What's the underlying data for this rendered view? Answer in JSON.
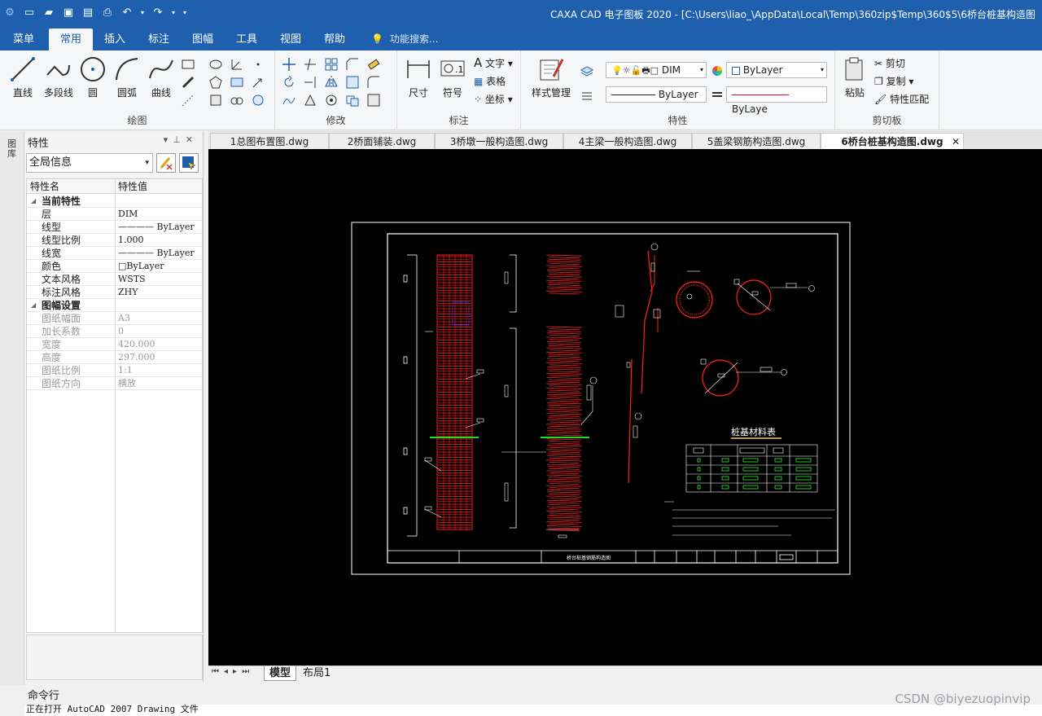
{
  "app": {
    "window_title": "CAXA CAD 电子图板 2020 - [C:\\Users\\liao_\\AppData\\Local\\Temp\\360zip$Temp\\360$5\\6桥台桩基构造图"
  },
  "menu": {
    "tabs": [
      "菜单",
      "常用",
      "插入",
      "标注",
      "图幅",
      "工具",
      "视图",
      "帮助"
    ],
    "active": "常用",
    "search_placeholder": "功能搜索..."
  },
  "ribbon": {
    "draw": {
      "label": "绘图",
      "line": "直线",
      "polyline": "多段线",
      "circle": "圆",
      "arc": "圆弧",
      "curve": "曲线"
    },
    "modify": {
      "label": "修改"
    },
    "annotate": {
      "label": "标注",
      "dim": "尺寸",
      "symbol": "符号",
      "text": "文字",
      "table": "表格",
      "coord": "坐标"
    },
    "properties": {
      "label": "特性",
      "style_mgr": "样式管理",
      "layer_value": "DIM",
      "color_value": "ByLayer",
      "linetype_value": "ByLayer",
      "linewidth_value": "ByLaye"
    },
    "clipboard": {
      "label": "剪切板",
      "paste": "粘贴",
      "cut": "剪切",
      "copy": "复制",
      "match": "特性匹配"
    }
  },
  "doc_tabs": [
    {
      "label": "1总图布置图.dwg",
      "active": false
    },
    {
      "label": "2桥面铺装.dwg",
      "active": false
    },
    {
      "label": "3桥墩一般构造图.dwg",
      "active": false
    },
    {
      "label": "4主梁一般构造图.dwg",
      "active": false
    },
    {
      "label": "5盖梁钢筋构造图.dwg",
      "active": false
    },
    {
      "label": "6桥台桩基构造图.dwg",
      "active": true
    }
  ],
  "left_strip": {
    "label": "图库"
  },
  "properties_panel": {
    "title": "特性",
    "selector": "全局信息",
    "col_name": "特性名",
    "col_value": "特性值",
    "rows": [
      {
        "type": "cat",
        "k": "当前特性",
        "v": ""
      },
      {
        "type": "row",
        "k": "层",
        "v": "DIM"
      },
      {
        "type": "row",
        "k": "线型",
        "v": "———— ByLayer"
      },
      {
        "type": "row",
        "k": "线型比例",
        "v": "1.000"
      },
      {
        "type": "row",
        "k": "线宽",
        "v": "———— ByLayer"
      },
      {
        "type": "row",
        "k": "颜色",
        "v": "□ByLayer"
      },
      {
        "type": "row",
        "k": "文本风格",
        "v": "WSTS"
      },
      {
        "type": "row",
        "k": "标注风格",
        "v": "ZHY"
      },
      {
        "type": "cat",
        "k": "图幅设置",
        "v": ""
      },
      {
        "type": "gray",
        "k": "图纸幅面",
        "v": "A3"
      },
      {
        "type": "gray",
        "k": "加长系数",
        "v": "0"
      },
      {
        "type": "gray",
        "k": "宽度",
        "v": "420.000"
      },
      {
        "type": "gray",
        "k": "高度",
        "v": "297.000"
      },
      {
        "type": "gray",
        "k": "图纸比例",
        "v": "1:1"
      },
      {
        "type": "gray",
        "k": "图纸方向",
        "v": "横放"
      }
    ]
  },
  "drawing": {
    "table_title": "桩基材料表",
    "title_block_text": "桥台桩基钢筋构造图"
  },
  "layout_tabs": [
    {
      "label": "模型",
      "active": true
    },
    {
      "label": "布局1",
      "active": false
    }
  ],
  "command": {
    "label": "命令行",
    "line": "正在打开 AutoCAD 2007 Drawing 文件"
  },
  "watermark": "CSDN @biyezuopinvip",
  "colors": {
    "title_blue": "#1e5fae",
    "rebar_red": "#e01010",
    "canvas_bg": "#000000"
  }
}
